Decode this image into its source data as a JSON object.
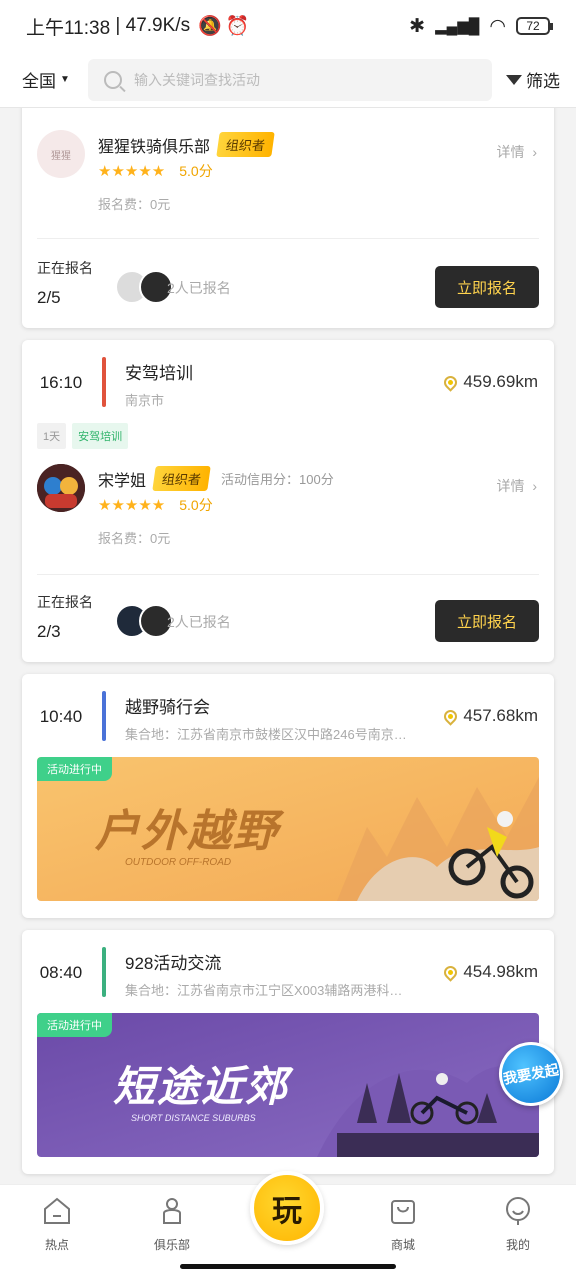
{
  "status": {
    "time": "上午11:38",
    "speed": "47.9K/s",
    "battery": "72"
  },
  "topbar": {
    "region": "全国",
    "search_placeholder": "输入关键词查找活动",
    "filter_label": "筛选"
  },
  "cards": [
    {
      "organizer": {
        "name": "猩猩铁骑俱乐部",
        "badge": "组织者",
        "rating": "5.0分",
        "fee": "报名费：0元",
        "detail": "详情"
      },
      "signup": {
        "label": "正在报名",
        "count": "2/5",
        "joined": "2人已报名",
        "button": "立即报名"
      }
    },
    {
      "time": "16:10",
      "title": "安驾培训",
      "location": "南京市",
      "distance": "459.69km",
      "accent": "#e0533c",
      "tags": [
        "1天",
        "安驾培训"
      ],
      "organizer": {
        "name": "宋学姐",
        "badge": "组织者",
        "credit": "活动信用分：100分",
        "rating": "5.0分",
        "fee": "报名费：0元",
        "detail": "详情"
      },
      "signup": {
        "label": "正在报名",
        "count": "2/3",
        "joined": "2人已报名",
        "button": "立即报名"
      }
    },
    {
      "time": "10:40",
      "title": "越野骑行会",
      "location": "集合地：江苏省南京市鼓楼区汉中路246号南京…",
      "distance": "457.68km",
      "accent": "#4a72d8",
      "banner": {
        "status": "活动进行中",
        "headline": "户外越野",
        "caption": "OUTDOOR OFF-ROAD"
      }
    },
    {
      "time": "08:40",
      "title": "928活动交流",
      "location": "集合地：江苏省南京市江宁区X003辅路两港科…",
      "distance": "454.98km",
      "accent": "#3bb07f",
      "banner": {
        "status": "活动进行中",
        "headline": "短途近郊",
        "caption": "SHORT DISTANCE SUBURBS"
      }
    }
  ],
  "fab": {
    "label": "我要发起"
  },
  "tabs": [
    {
      "label": "热点"
    },
    {
      "label": "俱乐部"
    },
    {
      "label": "玩"
    },
    {
      "label": "商城"
    },
    {
      "label": "我的"
    }
  ]
}
